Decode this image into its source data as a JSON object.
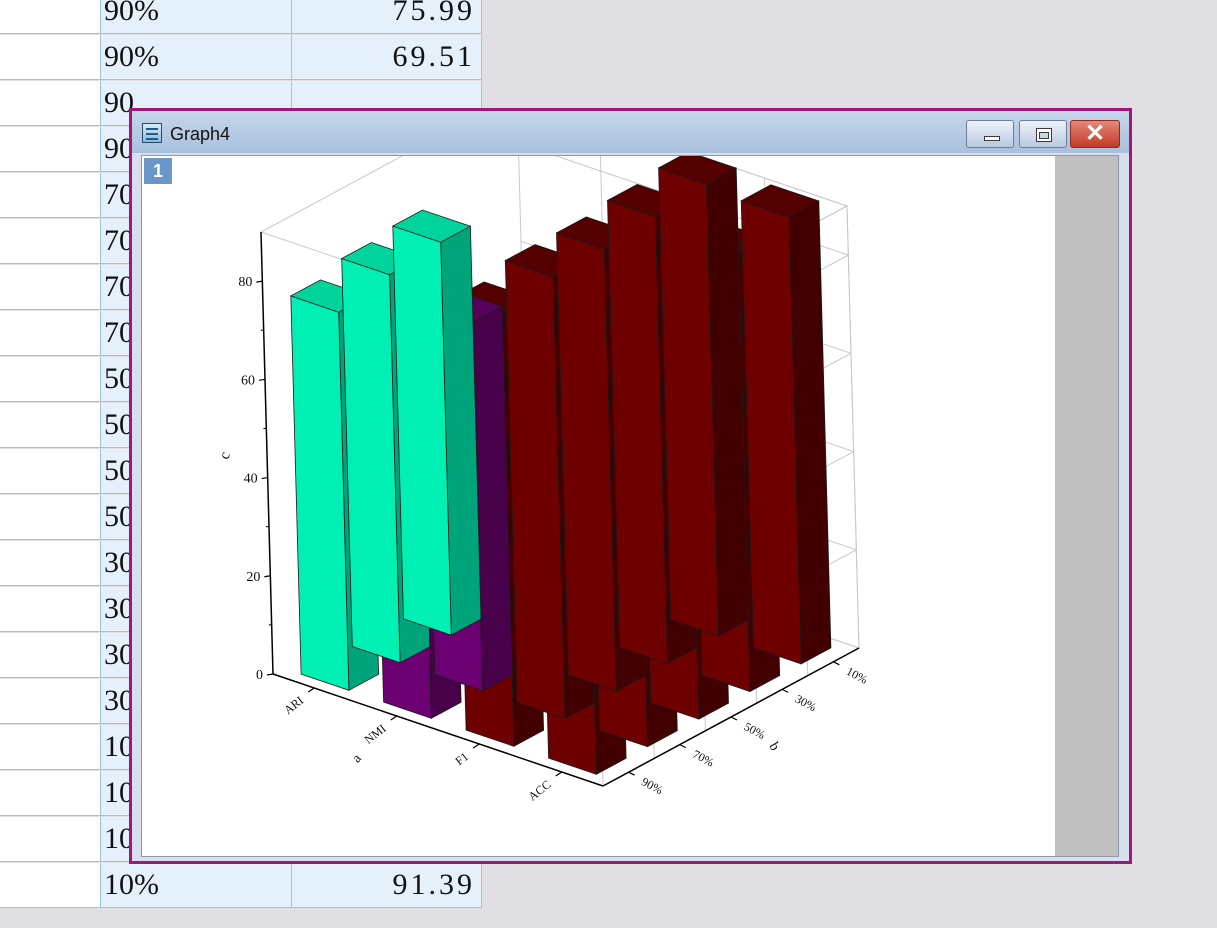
{
  "spreadsheet": {
    "rows": [
      {
        "p": "90%",
        "value": "75.99"
      },
      {
        "p": "90%",
        "value": "69.51"
      },
      {
        "p": "90",
        "value": ""
      },
      {
        "p": "90",
        "value": ""
      },
      {
        "p": "70",
        "value": ""
      },
      {
        "p": "70",
        "value": ""
      },
      {
        "p": "70",
        "value": ""
      },
      {
        "p": "70",
        "value": ""
      },
      {
        "p": "50",
        "value": ""
      },
      {
        "p": "50",
        "value": ""
      },
      {
        "p": "50",
        "value": ""
      },
      {
        "p": "50",
        "value": ""
      },
      {
        "p": "30",
        "value": ""
      },
      {
        "p": "30",
        "value": ""
      },
      {
        "p": "30",
        "value": ""
      },
      {
        "p": "30",
        "value": ""
      },
      {
        "p": "10",
        "value": ""
      },
      {
        "p": "10",
        "value": ""
      },
      {
        "p": "10",
        "value": ""
      },
      {
        "p": "10%",
        "value": "91.39"
      }
    ]
  },
  "window": {
    "title": "Graph4",
    "layer_badge": "1",
    "buttons": {
      "minimize": "minimize-icon",
      "maximize": "maximize-icon",
      "close": "close-icon"
    }
  },
  "colors": {
    "aqua": "#00f0b4",
    "purple": "#6c0073",
    "maroon": "#6e0000"
  },
  "chart_data": {
    "type": "bar3d",
    "z_label": "c",
    "x_label": "a",
    "y_label": "b",
    "z_ticks": [
      "0",
      "20",
      "40",
      "60",
      "80"
    ],
    "zlim": [
      0,
      90
    ],
    "x_categories": [
      "ARI",
      "NMI",
      "F1",
      "ACC"
    ],
    "y_categories": [
      "10%",
      "30%",
      "50%",
      "70%",
      "90%"
    ],
    "series": [
      {
        "metric": "ARI",
        "color": "aqua",
        "values": [
          null,
          null,
          80,
          79,
          77
        ]
      },
      {
        "metric": "NMI",
        "color": "purple",
        "values": [
          null,
          null,
          null,
          75,
          72
        ]
      },
      {
        "metric": "F1",
        "color": "maroon",
        "values": [
          92,
          91,
          90,
          90,
          88
        ]
      },
      {
        "metric": "ACC",
        "color": "maroon",
        "values": [
          91,
          89,
          88,
          87,
          86
        ]
      }
    ]
  }
}
